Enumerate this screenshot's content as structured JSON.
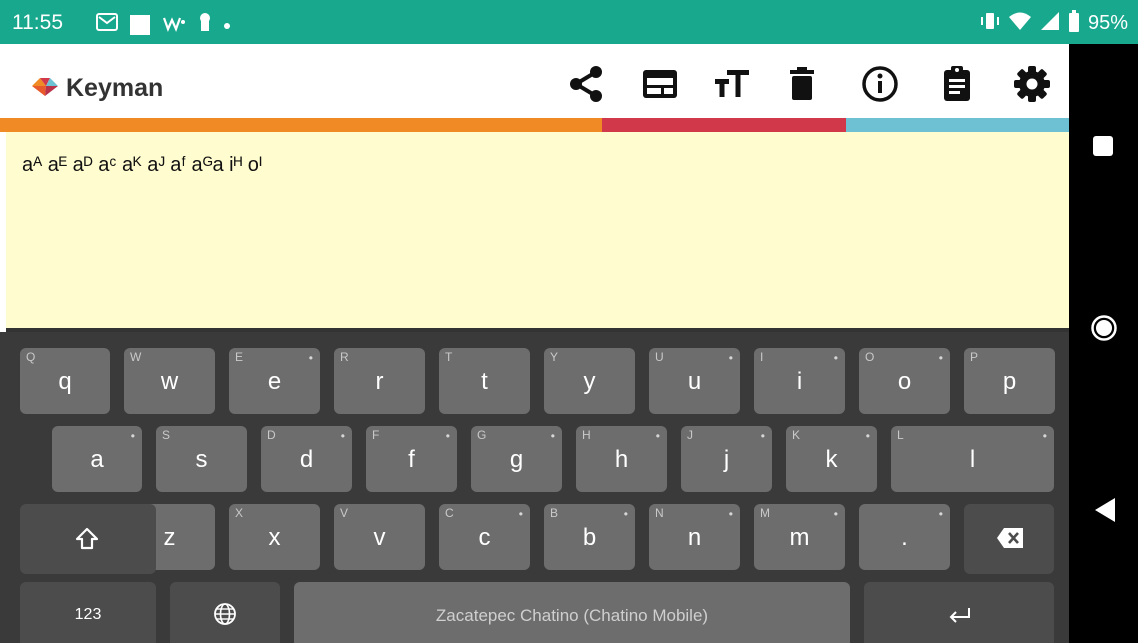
{
  "status_bar": {
    "time": "11:55",
    "battery": "95%",
    "left_icons": [
      "gmail-icon",
      "square-icon",
      "wp-icon",
      "keyhole-icon",
      "dot-icon"
    ],
    "right_icons": [
      "vibrate-icon",
      "wifi-icon",
      "signal-icon",
      "battery-icon"
    ]
  },
  "app_bar": {
    "app_name": "Keyman",
    "actions": [
      "share-icon",
      "keyboard-picker-icon",
      "text-size-icon",
      "trash-icon",
      "info-icon",
      "clipboard-icon",
      "settings-icon"
    ]
  },
  "color_bar": [
    "#f08a24",
    "#d1394a",
    "#6ec1d3"
  ],
  "editor": {
    "text": "aᴬ aᴱ aᴰ aᶜ aᴷ aᴶ aᶠ aᴳa iᴴ oᴵ"
  },
  "keyboard": {
    "rows": [
      [
        {
          "label": "q",
          "hint": "Q",
          "dot": false
        },
        {
          "label": "w",
          "hint": "W",
          "dot": false
        },
        {
          "label": "e",
          "hint": "E",
          "dot": true
        },
        {
          "label": "r",
          "hint": "R",
          "dot": false
        },
        {
          "label": "t",
          "hint": "T",
          "dot": false
        },
        {
          "label": "y",
          "hint": "Y",
          "dot": false
        },
        {
          "label": "u",
          "hint": "U",
          "dot": true
        },
        {
          "label": "i",
          "hint": "I",
          "dot": true
        },
        {
          "label": "o",
          "hint": "O",
          "dot": true
        },
        {
          "label": "p",
          "hint": "P",
          "dot": false
        }
      ],
      [
        {
          "label": "a",
          "hint": "",
          "dot": true
        },
        {
          "label": "s",
          "hint": "S",
          "dot": false
        },
        {
          "label": "d",
          "hint": "D",
          "dot": true
        },
        {
          "label": "f",
          "hint": "F",
          "dot": true
        },
        {
          "label": "g",
          "hint": "G",
          "dot": true
        },
        {
          "label": "h",
          "hint": "H",
          "dot": true
        },
        {
          "label": "j",
          "hint": "J",
          "dot": true
        },
        {
          "label": "k",
          "hint": "K",
          "dot": true
        },
        {
          "label": "l",
          "hint": "L",
          "dot": true
        }
      ],
      [
        {
          "label": "z",
          "hint": "Z",
          "dot": false
        },
        {
          "label": "x",
          "hint": "X",
          "dot": false
        },
        {
          "label": "v",
          "hint": "V",
          "dot": false
        },
        {
          "label": "c",
          "hint": "C",
          "dot": true
        },
        {
          "label": "b",
          "hint": "B",
          "dot": true
        },
        {
          "label": "n",
          "hint": "N",
          "dot": true
        },
        {
          "label": "m",
          "hint": "M",
          "dot": true
        },
        {
          "label": ".",
          "hint": "",
          "dot": true
        }
      ]
    ],
    "numbers_label": "123",
    "space_label": "Zacatepec Chatino (Chatino Mobile)"
  }
}
